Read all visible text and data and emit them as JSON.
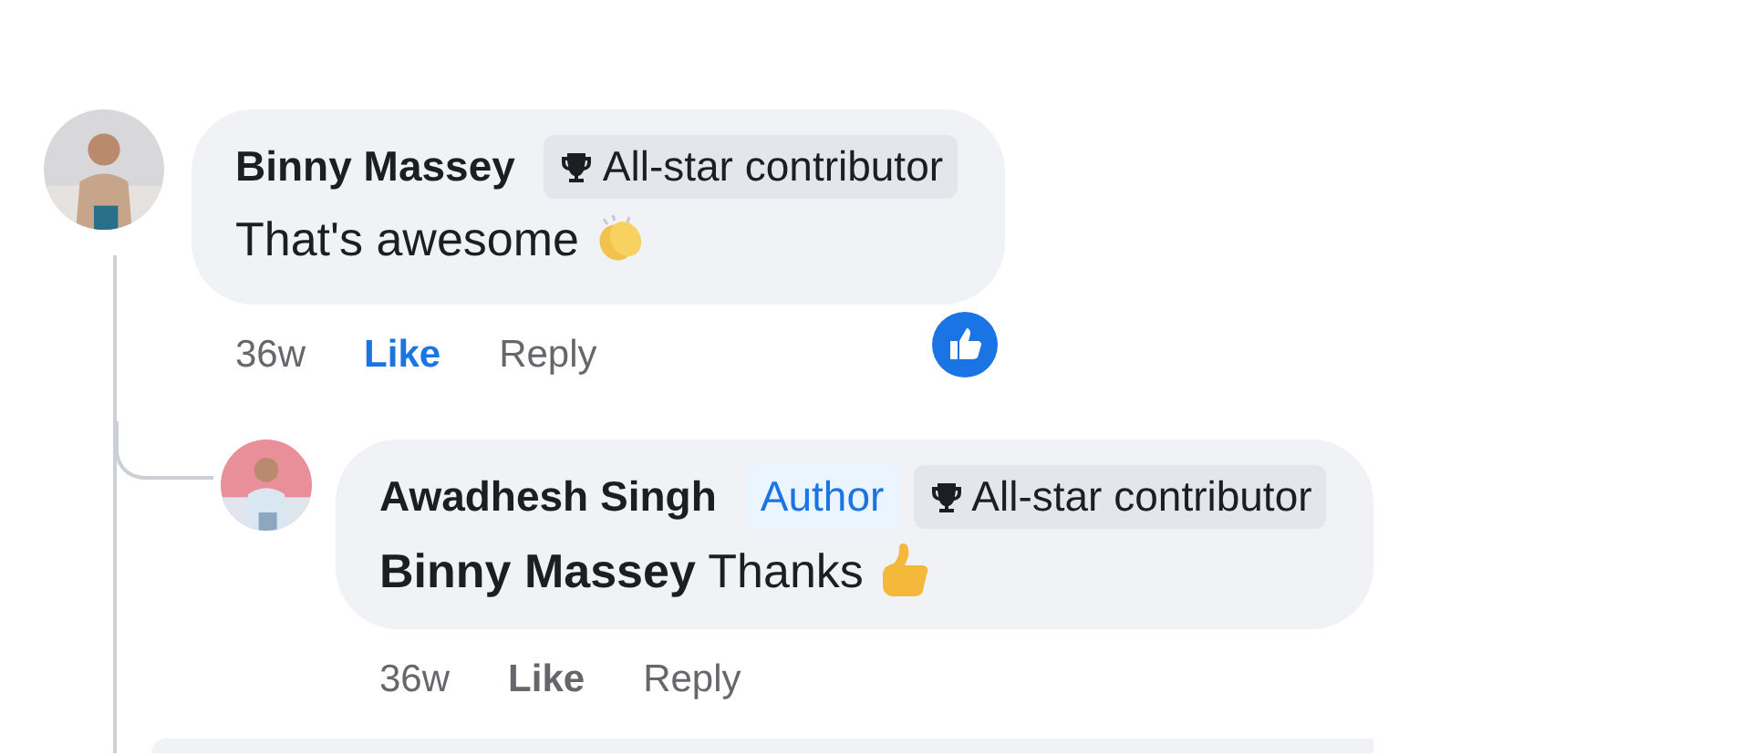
{
  "comments": [
    {
      "author": "Binny Massey",
      "badges": [
        {
          "kind": "all-star",
          "label": "All-star contributor"
        }
      ],
      "text": "That's awesome",
      "emoji": {
        "kind": "clap"
      },
      "time": "36w",
      "like_label": "Like",
      "liked": true,
      "reply_label": "Reply",
      "reacted": true,
      "replies": [
        {
          "author": "Awadhesh Singh",
          "badges": [
            {
              "kind": "author",
              "label": "Author"
            },
            {
              "kind": "all-star",
              "label": "All-star contributor"
            }
          ],
          "text": "**Binny Massey** Thanks",
          "emoji": {
            "kind": "thumbs-up"
          },
          "time": "36w",
          "like_label": "Like",
          "liked": false,
          "reply_label": "Reply",
          "reacted": false
        }
      ]
    }
  ]
}
